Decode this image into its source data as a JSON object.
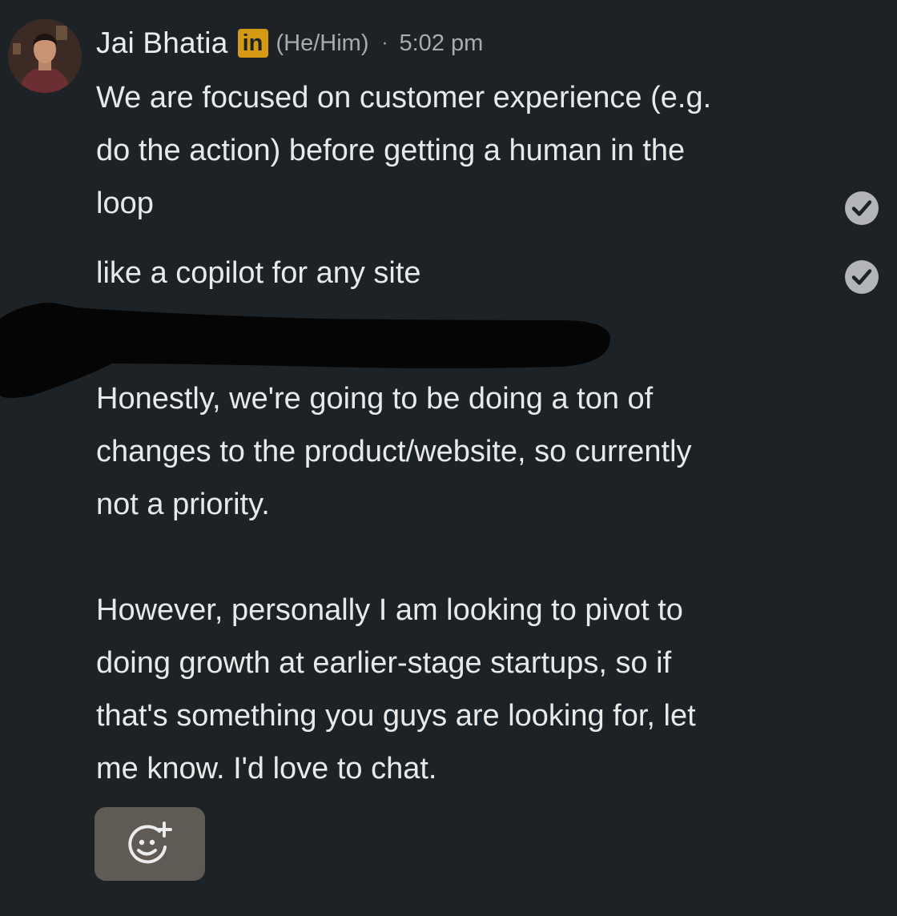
{
  "sender": {
    "name": "Jai Bhatia",
    "badge_text": "in",
    "pronouns": "(He/Him)",
    "separator": "·",
    "time": "5:02 pm"
  },
  "messages": [
    {
      "text": "We are focused on customer experience (e.g.\ndo the action) before getting a human in the\nloop",
      "status_icon": "check-circle-icon"
    },
    {
      "text": "like a copilot for any site",
      "status_icon": "check-circle-icon"
    },
    {
      "text": "Honestly, we're going to be doing a ton of\nchanges to the product/website, so currently\nnot a priority.\n\nHowever, personally I am looking to pivot to\ndoing growth at earlier-stage startups, so if\nthat's something you guys are looking for, let\nme know. I'd love to chat."
    }
  ],
  "actions": {
    "reaction_icon": "add-reaction-icon"
  },
  "colors": {
    "background": "#1d2226",
    "text": "#e9e9e9",
    "secondary_text": "#a9abad",
    "badge": "#d49a14",
    "reaction_button": "#5f5a53"
  }
}
